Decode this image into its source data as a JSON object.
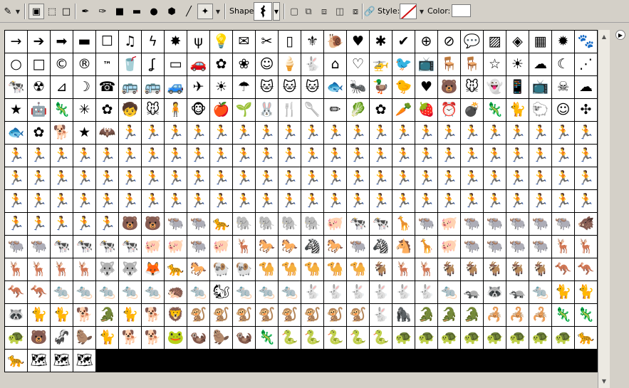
{
  "toolbar": {
    "tool_preset": "tool-preset-icon",
    "mode_buttons": [
      "shape-layers-icon",
      "paths-icon",
      "fill-pixels-icon"
    ],
    "tools": [
      "pen-icon",
      "freeform-pen-icon",
      "rectangle-icon",
      "rounded-rectangle-icon",
      "ellipse-icon",
      "polygon-icon",
      "line-icon",
      "custom-shape-icon"
    ],
    "shape_label": "Shape:",
    "combine_buttons": [
      "create-new-icon",
      "add-icon",
      "subtract-icon",
      "intersect-icon",
      "exclude-icon"
    ],
    "link_icon": "chain-icon",
    "style_label": "Style:",
    "color_label": "Color:",
    "color_value": "#ffffff"
  },
  "shapes": [
    "→",
    "➔",
    "➡",
    "▬",
    "☐",
    "♫",
    "ϟ",
    "✸",
    "ψ",
    "💡",
    "✉",
    "✂",
    "▯",
    "⚜",
    "🐌",
    "♥",
    "✱",
    "✔",
    "⊕",
    "⊘",
    "💬",
    "▨",
    "◈",
    "▦",
    "✹",
    "🐾",
    "○",
    "□",
    "©",
    "®",
    "™",
    "🥤",
    "ʆ",
    "▭",
    "🚗",
    "✿",
    "❀",
    "☺",
    "🍦",
    "🐇",
    "⌂",
    "♡",
    "🚁",
    "🐦",
    "📺",
    "🪑",
    "🪑",
    "☆",
    "☀",
    "☁",
    "☾",
    "⋰",
    "🐄",
    "☢",
    "⊿",
    "☽",
    "☎",
    "🚌",
    "🚌",
    "🚙",
    "✈",
    "☀",
    "☂",
    "🐱",
    "🐱",
    "🐱",
    "🐟",
    "🐜",
    "🦆",
    "🐤",
    "♥",
    "🐻",
    "🐭",
    "👻",
    "📱",
    "📺",
    "☠",
    "☁",
    "★",
    "🤖",
    "🦎",
    "✳",
    "✿",
    "🧒",
    "🐭",
    "🧍",
    "🐵",
    "🍎",
    "🌱",
    "🐰",
    "🍴",
    "🥄",
    "✏",
    "🥬",
    "✿",
    "🥕",
    "🍓",
    "⏰",
    "💣",
    "🦎",
    "🐈",
    "🐑",
    "☺",
    "✣",
    "🐟",
    "✿",
    "🐕",
    "★",
    "🦇",
    "🏃",
    "🏃",
    "🏃",
    "🏃",
    "🏃",
    "🏃",
    "🏃",
    "🏃",
    "🏃",
    "🏃",
    "🏃",
    "🏃",
    "🏃",
    "🏃",
    "🏃",
    "🏃",
    "🏃",
    "🏃",
    "🏃",
    "🏃",
    "🏃",
    "🏃",
    "🏃",
    "🏃",
    "🏃",
    "🏃",
    "🏃",
    "🏃",
    "🏃",
    "🏃",
    "🏃",
    "🏃",
    "🏃",
    "🏃",
    "🏃",
    "🏃",
    "🏃",
    "🏃",
    "🏃",
    "🏃",
    "🏃",
    "🏃",
    "🏃",
    "🏃",
    "🏃",
    "🏃",
    "🏃",
    "🏃",
    "🏃",
    "🏃",
    "🏃",
    "🏃",
    "🏃",
    "🏃",
    "🏃",
    "🏃",
    "🏃",
    "🏃",
    "🏃",
    "🏃",
    "🏃",
    "🏃",
    "🏃",
    "🏃",
    "🏃",
    "🏃",
    "🏃",
    "🏃",
    "🏃",
    "🏃",
    "🏃",
    "🏃",
    "🏃",
    "🏃",
    "🏃",
    "🏃",
    "🏃",
    "🏃",
    "🏃",
    "🏃",
    "🏃",
    "🏃",
    "🏃",
    "🏃",
    "🏃",
    "🏃",
    "🏃",
    "🏃",
    "🏃",
    "🏃",
    "🏃",
    "🏃",
    "🏃",
    "🏃",
    "🏃",
    "🏃",
    "🏃",
    "🏃",
    "🏃",
    "🏃",
    "🏃",
    "🏃",
    "🏃",
    "🏃",
    "🐻",
    "🐻",
    "🐃",
    "🐃",
    "🐆",
    "🐘",
    "🐘",
    "🐘",
    "🐘",
    "🐖",
    "🐄",
    "🐄",
    "🦒",
    "🐃",
    "🐖",
    "🐃",
    "🐃",
    "🐃",
    "🐃",
    "🐃",
    "🐗",
    "🐃",
    "🐃",
    "🐄",
    "🐄",
    "🐄",
    "🐄",
    "🐖",
    "🐖",
    "🐃",
    "🐖",
    "🦌",
    "🐎",
    "🐎",
    "🦓",
    "🐎",
    "🐃",
    "🦓",
    "🐴",
    "🦒",
    "🐖",
    "🐃",
    "🐃",
    "🐃",
    "🐃",
    "🦌",
    "🦌",
    "🦌",
    "🦌",
    "🦌",
    "🦌",
    "🐺",
    "🐺",
    "🦊",
    "🐆",
    "🐎",
    "🐏",
    "🐏",
    "🐪",
    "🐪",
    "🐪",
    "🐪",
    "🐪",
    "🐐",
    "🦌",
    "🦌",
    "🐐",
    "🐐",
    "🐐",
    "🐐",
    "🐐",
    "🦘",
    "🦘",
    "🦘",
    "🦘",
    "🐀",
    "🐀",
    "🐀",
    "🐀",
    "🐀",
    "🦔",
    "🐀",
    "🐿",
    "🐀",
    "🐀",
    "🐀",
    "🐇",
    "🐇",
    "🐇",
    "🐇",
    "🐇",
    "🐇",
    "🐀",
    "🦡",
    "🦝",
    "🦡",
    "🐀",
    "🐈",
    "🐈",
    "🦝",
    "🐈",
    "🐈",
    "🐕",
    "🐊",
    "🐈",
    "🐕",
    "🦁",
    "🐒",
    "🐒",
    "🐒",
    "🐒",
    "🐒",
    "🐒",
    "🐒",
    "🐒",
    "🐇",
    "🦍",
    "🐊",
    "🐊",
    "🐊",
    "🦂",
    "🦂",
    "🦂",
    "🦎",
    "🦎",
    "🐢",
    "🐻",
    "🦨",
    "🦫",
    "🐈",
    "🐕",
    "🐕",
    "🐸",
    "🦦",
    "🦫",
    "🦦",
    "🦎",
    "🐍",
    "🐍",
    "🐍",
    "🐍",
    "🐍",
    "🐢",
    "🐢",
    "🐢",
    "🐢",
    "🐢",
    "🐢",
    "🐢",
    "🐢",
    "🐆",
    "🐆",
    "🗺",
    "🗺",
    "🗺"
  ],
  "scrollbar": {
    "up": "scroll-up-arrow",
    "down": "scroll-down-arrow"
  },
  "panel_menu": "panel-menu-icon"
}
